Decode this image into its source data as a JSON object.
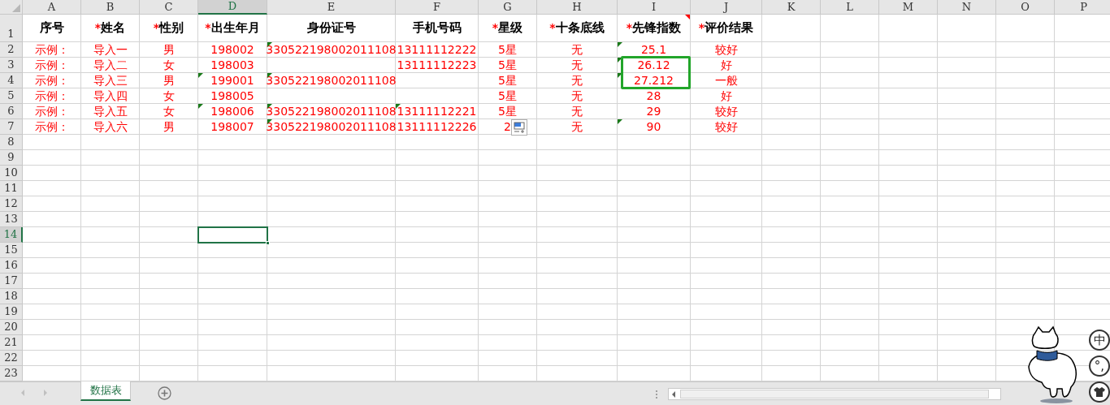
{
  "columns": [
    {
      "letter": "A",
      "selected": false
    },
    {
      "letter": "B",
      "selected": false
    },
    {
      "letter": "C",
      "selected": false
    },
    {
      "letter": "D",
      "selected": true
    },
    {
      "letter": "E",
      "selected": false
    },
    {
      "letter": "F",
      "selected": false
    },
    {
      "letter": "G",
      "selected": false
    },
    {
      "letter": "H",
      "selected": false
    },
    {
      "letter": "I",
      "selected": false
    },
    {
      "letter": "J",
      "selected": false
    },
    {
      "letter": "K",
      "selected": false
    },
    {
      "letter": "L",
      "selected": false
    },
    {
      "letter": "M",
      "selected": false
    },
    {
      "letter": "N",
      "selected": false
    },
    {
      "letter": "O",
      "selected": false
    },
    {
      "letter": "P",
      "selected": false
    }
  ],
  "row_numbers": [
    {
      "label": "1",
      "selected": false
    },
    {
      "label": "2",
      "selected": false
    },
    {
      "label": "3",
      "selected": false
    },
    {
      "label": "4",
      "selected": false
    },
    {
      "label": "5",
      "selected": false
    },
    {
      "label": "6",
      "selected": false
    },
    {
      "label": "7",
      "selected": false
    },
    {
      "label": "8",
      "selected": false
    },
    {
      "label": "9",
      "selected": false
    },
    {
      "label": "10",
      "selected": false
    },
    {
      "label": "11",
      "selected": false
    },
    {
      "label": "12",
      "selected": false
    },
    {
      "label": "13",
      "selected": false
    },
    {
      "label": "14",
      "selected": true
    },
    {
      "label": "15",
      "selected": false
    },
    {
      "label": "16",
      "selected": false
    },
    {
      "label": "17",
      "selected": false
    },
    {
      "label": "18",
      "selected": false
    },
    {
      "label": "19",
      "selected": false
    },
    {
      "label": "20",
      "selected": false
    },
    {
      "label": "21",
      "selected": false
    },
    {
      "label": "22",
      "selected": false
    },
    {
      "label": "23",
      "selected": false
    }
  ],
  "header_row": [
    {
      "label": "序号",
      "comment": false
    },
    {
      "mark": "*",
      "label": "姓名",
      "comment": false
    },
    {
      "mark": "*",
      "label": "性别",
      "comment": false
    },
    {
      "mark": "*",
      "label": "出生年月",
      "comment": false
    },
    {
      "label": "身份证号",
      "comment": false
    },
    {
      "label": "手机号码",
      "comment": false
    },
    {
      "mark": "*",
      "label": "星级",
      "comment": false
    },
    {
      "mark": "*",
      "label": "十条底线",
      "comment": false
    },
    {
      "mark": "*",
      "label": "先锋指数",
      "comment": true
    },
    {
      "mark": "*",
      "label": "评价结果",
      "comment": false
    }
  ],
  "data_rows": [
    [
      {
        "text": "示例：",
        "flag": false
      },
      {
        "text": "导入一",
        "flag": false
      },
      {
        "text": "男",
        "flag": false
      },
      {
        "text": "198002",
        "flag": false
      },
      {
        "text": "330522198002011108",
        "flag": true
      },
      {
        "text": "13111112222",
        "flag": false
      },
      {
        "text": "5星",
        "flag": false
      },
      {
        "text": "无",
        "flag": false
      },
      {
        "text": "25.1",
        "flag": true
      },
      {
        "text": "较好",
        "flag": false
      }
    ],
    [
      {
        "text": "示例：",
        "flag": false
      },
      {
        "text": "导入二",
        "flag": false
      },
      {
        "text": "女",
        "flag": false
      },
      {
        "text": "198003",
        "flag": false
      },
      null,
      {
        "text": "13111112223",
        "flag": false
      },
      {
        "text": "5星",
        "flag": false
      },
      {
        "text": "无",
        "flag": false
      },
      {
        "text": "26.12",
        "flag": true
      },
      {
        "text": "好",
        "flag": false
      }
    ],
    [
      {
        "text": "示例：",
        "flag": false
      },
      {
        "text": "导入三",
        "flag": false
      },
      {
        "text": "男",
        "flag": false
      },
      {
        "text": "199001",
        "flag": true
      },
      {
        "text": "330522198002011108",
        "flag": true
      },
      null,
      {
        "text": "5星",
        "flag": false
      },
      {
        "text": "无",
        "flag": false
      },
      {
        "text": "27.212",
        "flag": true
      },
      {
        "text": "一般",
        "flag": false
      }
    ],
    [
      {
        "text": "示例：",
        "flag": false
      },
      {
        "text": "导入四",
        "flag": false
      },
      {
        "text": "女",
        "flag": false
      },
      {
        "text": "198005",
        "flag": false
      },
      null,
      null,
      {
        "text": "5星",
        "flag": false
      },
      {
        "text": "无",
        "flag": false
      },
      {
        "text": "28",
        "flag": false
      },
      {
        "text": "好",
        "flag": false
      }
    ],
    [
      {
        "text": "示例：",
        "flag": false
      },
      {
        "text": "导入五",
        "flag": false
      },
      {
        "text": "女",
        "flag": false
      },
      {
        "text": "198006",
        "flag": true
      },
      {
        "text": "330522198002011108",
        "flag": true
      },
      {
        "text": "13111112221",
        "flag": true
      },
      {
        "text": "5星",
        "flag": false
      },
      {
        "text": "无",
        "flag": false
      },
      {
        "text": "29",
        "flag": false
      },
      {
        "text": "较好",
        "flag": false
      }
    ],
    [
      {
        "text": "示例：",
        "flag": false
      },
      {
        "text": "导入六",
        "flag": false
      },
      {
        "text": "男",
        "flag": false
      },
      {
        "text": "198007",
        "flag": false
      },
      {
        "text": "330522198002011108",
        "flag": true
      },
      {
        "text": "13111112226",
        "flag": false
      },
      {
        "text": "2",
        "flag": false
      },
      {
        "text": "无",
        "flag": false
      },
      {
        "text": "90",
        "flag": true
      },
      {
        "text": "较好",
        "flag": false
      }
    ]
  ],
  "sheet_tabs": [
    {
      "label": "数据表",
      "selected": true
    }
  ],
  "ime_buttons": [
    {
      "kind": "text",
      "label": "中"
    },
    {
      "kind": "text",
      "label": "°,"
    },
    {
      "kind": "shirt"
    }
  ]
}
